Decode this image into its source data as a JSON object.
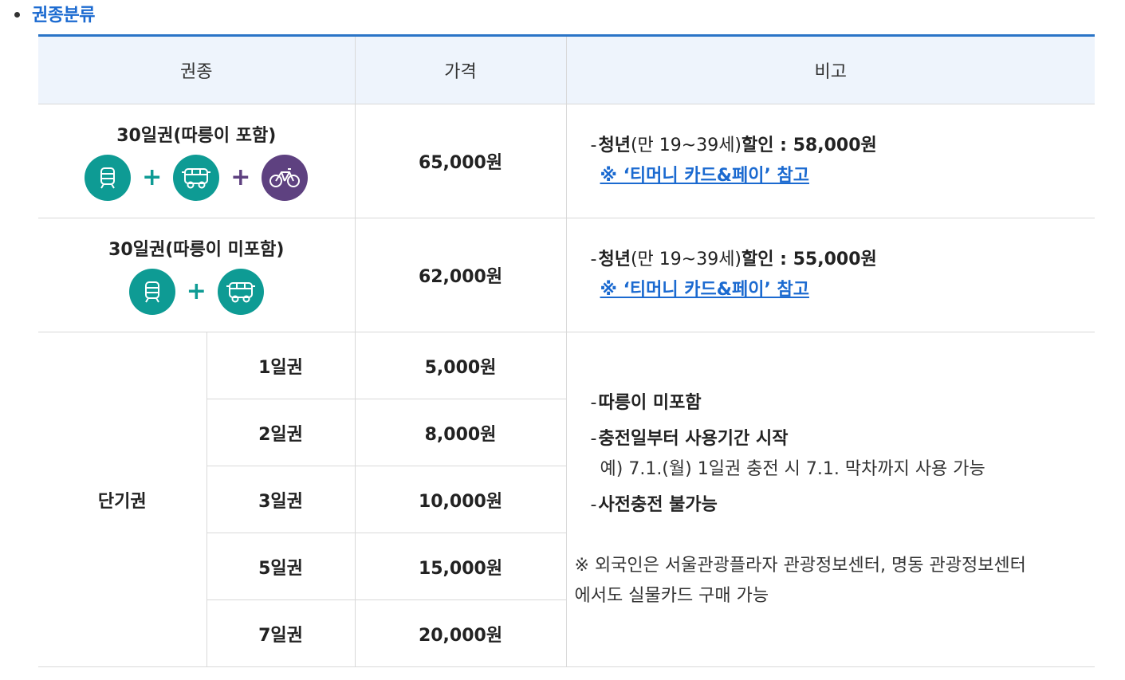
{
  "section": {
    "title": "권종분류"
  },
  "table": {
    "headers": {
      "type": "권종",
      "price": "가격",
      "note": "비고"
    },
    "rows_30": [
      {
        "name": "30일권(따릉이 포함)",
        "price": "65,000원",
        "note_bold1": "청년",
        "note_normal": "(만 19~39세)",
        "note_bold2": "할인 : 58,000원",
        "note_link": "※ ‘티머니 카드&페이’ 참고"
      },
      {
        "name": "30일권(따릉이 미포함)",
        "price": "62,000원",
        "note_bold1": "청년",
        "note_normal": "(만 19~39세)",
        "note_bold2": "할인 : 55,000원",
        "note_link": "※ ‘티머니 카드&페이’ 참고"
      }
    ],
    "short": {
      "group_label": "단기권",
      "items": [
        {
          "name": "1일권",
          "price": "5,000원"
        },
        {
          "name": "2일권",
          "price": "8,000원"
        },
        {
          "name": "3일권",
          "price": "10,000원"
        },
        {
          "name": "5일권",
          "price": "15,000원"
        },
        {
          "name": "7일권",
          "price": "20,000원"
        }
      ],
      "notes": {
        "line1": "따릉이 미포함",
        "line2": "충전일부터 사용기간 시작",
        "line2_sub": "예) 7.1.(월) 1일권 충전 시 7.1. 막차까지 사용 가능",
        "line3": "사전충전 불가능",
        "foreign1": "※  외국인은 서울관광플라자 관광정보센터, 명동 관광정보센터",
        "foreign2": "에서도 실물카드 구매 가능"
      }
    }
  },
  "icons": {
    "subway": "subway-icon",
    "bus": "bus-icon",
    "bike": "bicycle-icon",
    "plus": "+"
  },
  "colors": {
    "teal": "#0e9b94",
    "purple": "#5e4180",
    "accent": "#1b6ad0"
  }
}
